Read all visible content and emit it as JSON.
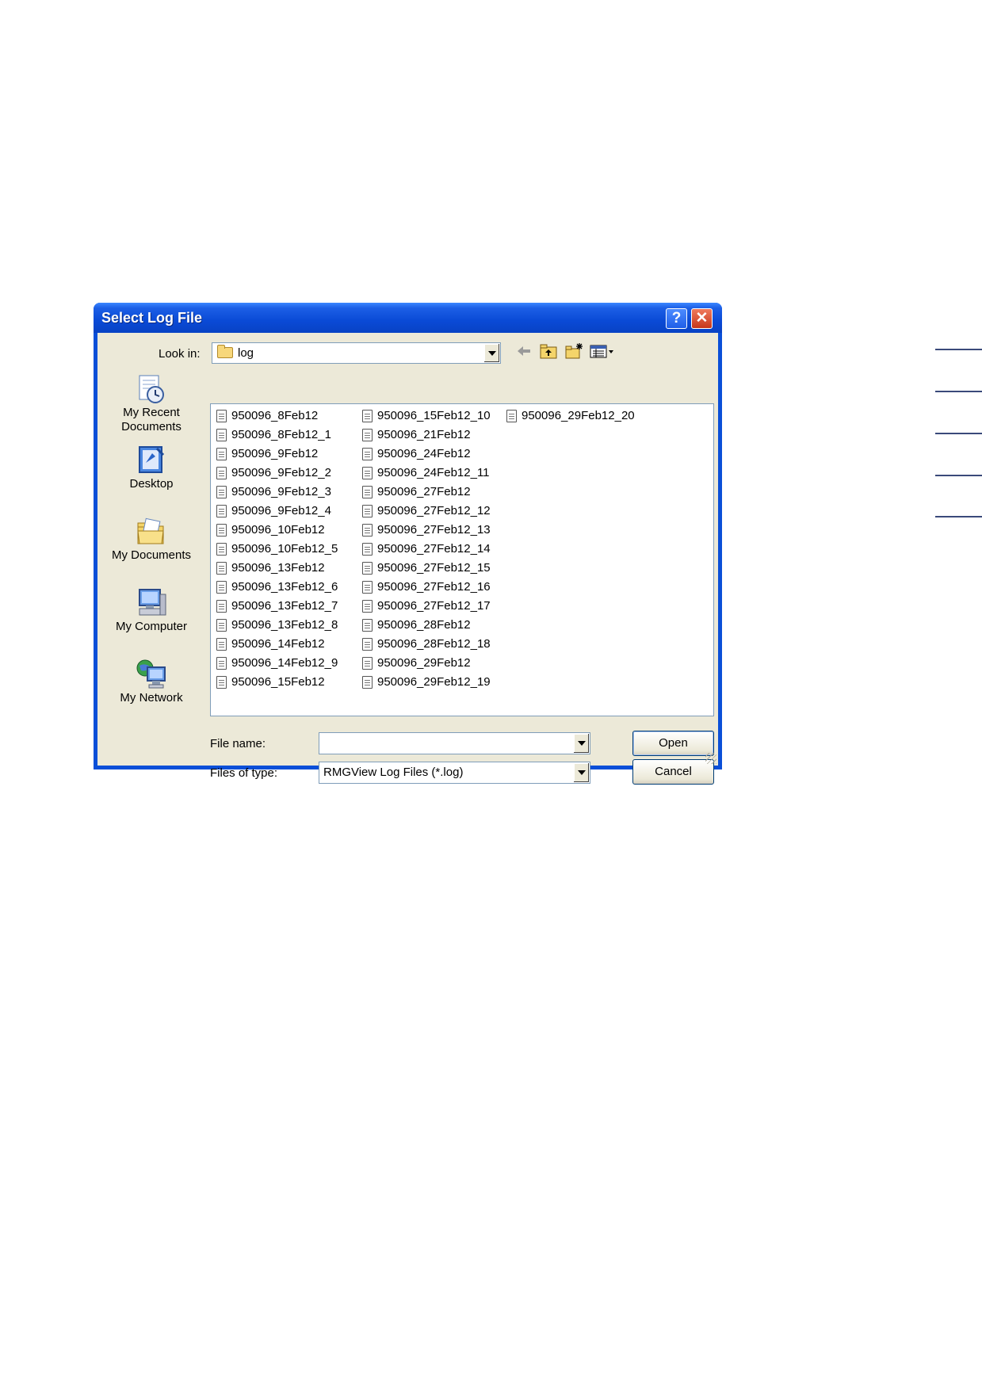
{
  "dialog": {
    "title": "Select Log File",
    "help_label": "?",
    "close_label": "✕"
  },
  "look_in": {
    "label": "Look in:",
    "value": "log"
  },
  "toolbar": {
    "back_icon": "back-arrow-icon",
    "up_icon": "up-one-level-icon",
    "new_folder_icon": "new-folder-icon",
    "views_icon": "views-menu-icon"
  },
  "places": [
    {
      "label_line1": "My Recent",
      "label_line2": "Documents",
      "icon": "recent-documents-icon"
    },
    {
      "label_line1": "Desktop",
      "label_line2": "",
      "icon": "desktop-icon"
    },
    {
      "label_line1": "My Documents",
      "label_line2": "",
      "icon": "my-documents-icon"
    },
    {
      "label_line1": "My Computer",
      "label_line2": "",
      "icon": "my-computer-icon"
    },
    {
      "label_line1": "My Network",
      "label_line2": "",
      "icon": "my-network-icon"
    }
  ],
  "files": {
    "col1": [
      "950096_8Feb12",
      "950096_8Feb12_1",
      "950096_9Feb12",
      "950096_9Feb12_2",
      "950096_9Feb12_3",
      "950096_9Feb12_4",
      "950096_10Feb12",
      "950096_10Feb12_5",
      "950096_13Feb12",
      "950096_13Feb12_6",
      "950096_13Feb12_7",
      "950096_13Feb12_8",
      "950096_14Feb12",
      "950096_14Feb12_9",
      "950096_15Feb12"
    ],
    "col2": [
      "950096_15Feb12_10",
      "950096_21Feb12",
      "950096_24Feb12",
      "950096_24Feb12_11",
      "950096_27Feb12",
      "950096_27Feb12_12",
      "950096_27Feb12_13",
      "950096_27Feb12_14",
      "950096_27Feb12_15",
      "950096_27Feb12_16",
      "950096_27Feb12_17",
      "950096_28Feb12",
      "950096_28Feb12_18",
      "950096_29Feb12",
      "950096_29Feb12_19"
    ],
    "col3": [
      "950096_29Feb12_20"
    ]
  },
  "file_name": {
    "label": "File name:",
    "value": ""
  },
  "file_type": {
    "label": "Files of type:",
    "value": "RMGView Log Files (*.log)"
  },
  "buttons": {
    "open": "Open",
    "cancel": "Cancel"
  }
}
